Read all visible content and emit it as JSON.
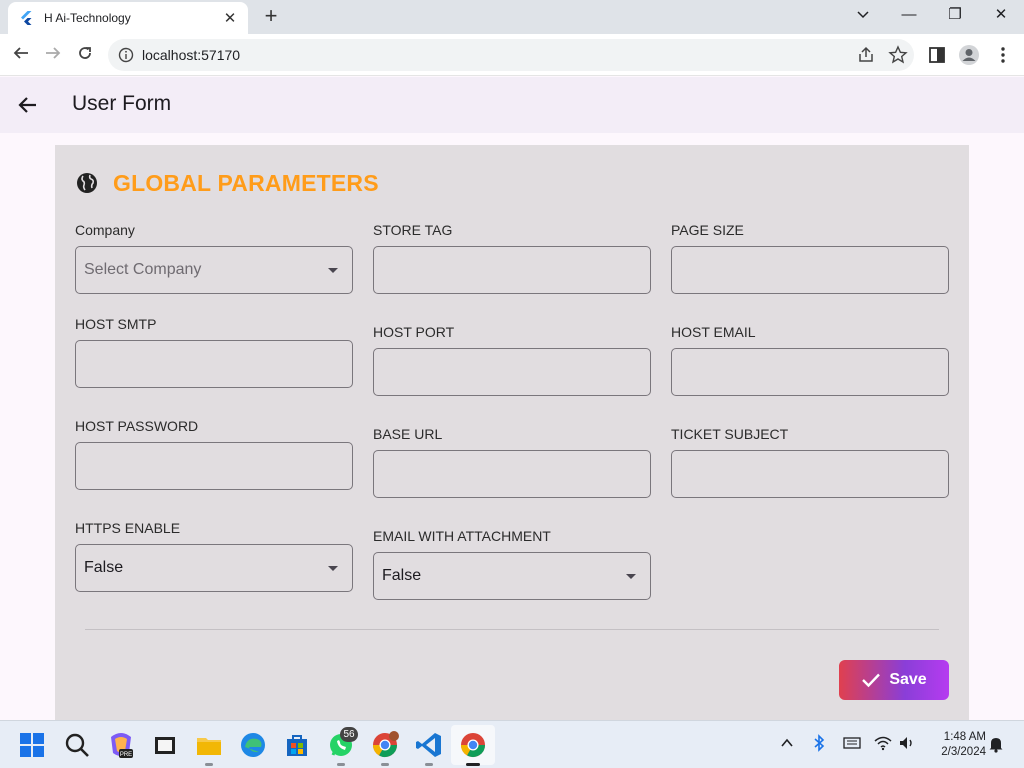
{
  "browser": {
    "tab_title": "H Ai-Technology",
    "tab_close": "✕",
    "new_tab": "+",
    "url": "localhost:57170",
    "window_controls": {
      "minimize": "—",
      "restore": "❐",
      "close": "✕",
      "list": "⌄"
    }
  },
  "appbar": {
    "title": "User Form"
  },
  "section": {
    "title": "GLOBAL PARAMETERS",
    "icon": "globe-icon"
  },
  "fields": {
    "company": {
      "label": "Company",
      "placeholder": "Select Company"
    },
    "store_tag": {
      "label": "STORE TAG",
      "value": ""
    },
    "page_size": {
      "label": "PAGE SIZE",
      "value": ""
    },
    "host_smtp": {
      "label": "HOST SMTP",
      "value": ""
    },
    "host_port": {
      "label": "HOST PORT",
      "value": ""
    },
    "host_email": {
      "label": "HOST EMAIL",
      "value": ""
    },
    "host_password": {
      "label": "HOST PASSWORD",
      "value": ""
    },
    "base_url": {
      "label": "BASE URL",
      "value": ""
    },
    "ticket_subject": {
      "label": "TICKET SUBJECT",
      "value": ""
    },
    "https_enable": {
      "label": "HTTPS ENABLE",
      "value": "False"
    },
    "email_with_attachment": {
      "label": "EMAIL WITH ATTACHMENT",
      "value": "False"
    }
  },
  "actions": {
    "save_label": "Save"
  },
  "taskbar": {
    "whatsapp_badge": "56",
    "time": "1:48 AM",
    "date": "2/3/2024"
  },
  "colors": {
    "accent_orange": "#ff9c1a",
    "panel_bg": "#e1dde0",
    "appbar_bg": "#f3edf7",
    "save_gradient_start": "#e0404f",
    "save_gradient_end": "#b63cf0"
  }
}
